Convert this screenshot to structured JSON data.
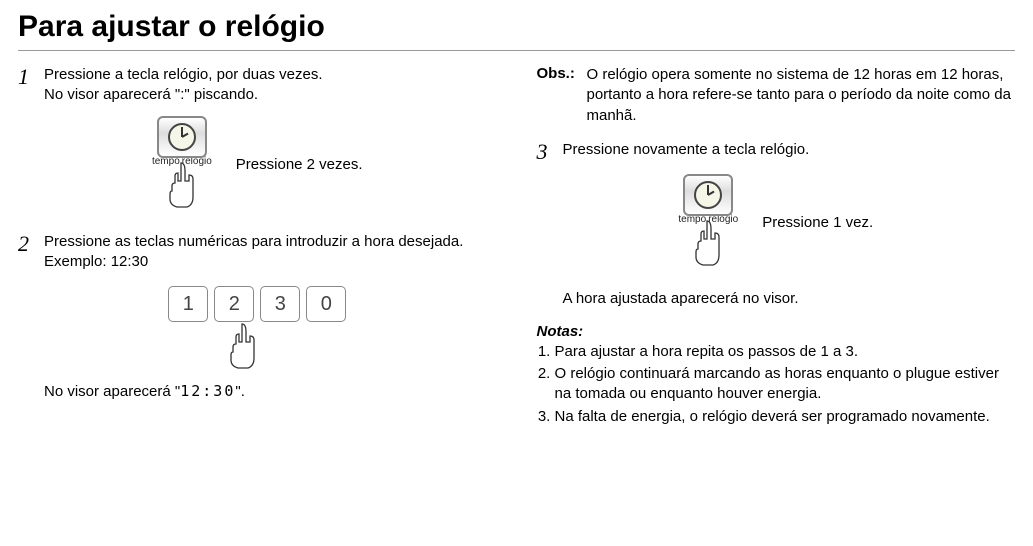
{
  "title": "Para ajustar o relógio",
  "left": {
    "step1": {
      "num": "1",
      "line1": "Pressione a tecla relógio, por duas vezes.",
      "line2": "No visor aparecerá \":\" piscando."
    },
    "button_label_left": "tempo",
    "button_label_right": "relógio",
    "press2": "Pressione 2 vezes.",
    "step2": {
      "num": "2",
      "line1": "Pressione as teclas numéricas para introduzir a hora desejada.",
      "line2": "Exemplo: 12:30"
    },
    "keys": [
      "1",
      "2",
      "3",
      "0"
    ],
    "display_prefix": "No visor aparecerá \"",
    "display_value": "12:30",
    "display_suffix": "\"."
  },
  "right": {
    "obs_label": "Obs.:",
    "obs_text": "O relógio opera somente no sistema de 12 horas em 12 horas, portanto a hora refere-se tanto para o período da noite como da manhã.",
    "step3": {
      "num": "3",
      "text": "Pressione novamente a tecla relógio."
    },
    "button_label_left": "tempo",
    "button_label_right": "relógio",
    "press1": "Pressione 1 vez.",
    "after3": "A hora ajustada aparecerá no visor.",
    "notes_title": "Notas:",
    "notes": [
      "Para ajustar a hora repita os passos de 1 a 3.",
      "O relógio continuará marcando as horas enquanto o plugue estiver na tomada ou enquanto houver energia.",
      "Na falta de energia, o relógio deverá ser programado novamente."
    ]
  }
}
